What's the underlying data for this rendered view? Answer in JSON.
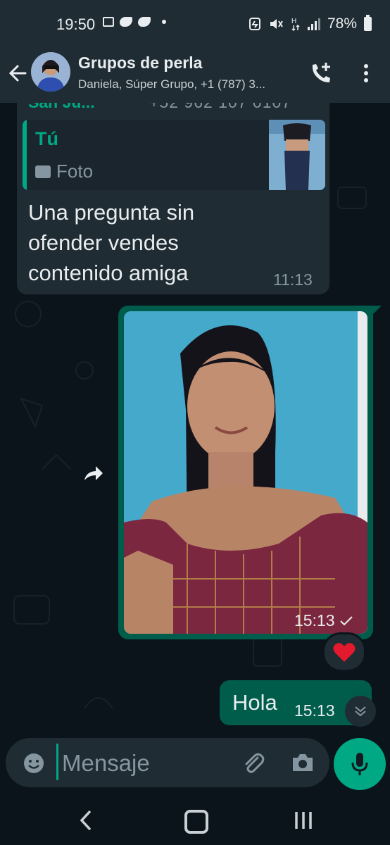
{
  "status_bar": {
    "time": "19:50",
    "battery": "78%",
    "icons": [
      "gallery-icon",
      "twitter-icon",
      "twitter-icon",
      "notification-dot-icon",
      "saver-icon",
      "mute-icon",
      "data-icon",
      "signal-icon",
      "battery-icon"
    ]
  },
  "header": {
    "title": "Grupos de perla",
    "subtitle": "Daniela, Súper Grupo, +1 (787) 3...",
    "icons": [
      "back-arrow-icon",
      "add-call-icon",
      "more-vert-icon"
    ]
  },
  "chat": {
    "cutoff_sender": "San Ju...",
    "cutoff_phone": "+52 962 107 0107",
    "quoted": {
      "author": "Tú",
      "kind": "Foto"
    },
    "incoming_message": {
      "text": "Una pregunta sin ofender vendes contenido amiga",
      "time": "11:13"
    },
    "outgoing_image": {
      "time": "15:13",
      "status": "sent",
      "reaction": "❤️"
    },
    "outgoing_text": {
      "text": "Hola",
      "time": "15:13"
    }
  },
  "composer": {
    "placeholder": "Mensaje",
    "icons": [
      "emoji-icon",
      "attach-icon",
      "camera-icon",
      "mic-icon"
    ]
  },
  "colors": {
    "accent": "#00a884",
    "outgoing_bubble": "#005c4b",
    "incoming_bubble": "#1f2c34",
    "background": "#0b141a"
  }
}
